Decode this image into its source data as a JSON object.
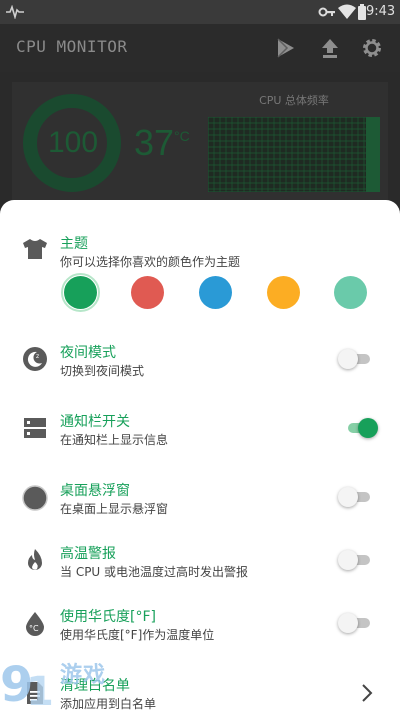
{
  "status_bar": {
    "time": "9:43"
  },
  "app": {
    "title": "CPU MONITOR"
  },
  "toolbar": {
    "icons": [
      "play-store-icon",
      "upload-icon",
      "settings-gear-icon"
    ]
  },
  "dashboard": {
    "load_percent": "100",
    "temperature": "37",
    "temperature_unit": "°C",
    "frequency_label": "CPU 总体频率"
  },
  "settings": {
    "theme": {
      "title": "主题",
      "subtitle": "你可以选择你喜欢的颜色作为主题",
      "colors": [
        "#17a05a",
        "#e05a52",
        "#2a9ad6",
        "#fcad23",
        "#6acaaa"
      ],
      "selected_index": 0
    },
    "night_mode": {
      "title": "夜间模式",
      "subtitle": "切换到夜间模式",
      "enabled": false
    },
    "notification": {
      "title": "通知栏开关",
      "subtitle": "在通知栏上显示信息",
      "enabled": true
    },
    "floating_window": {
      "title": "桌面悬浮窗",
      "subtitle": "在桌面上显示悬浮窗",
      "enabled": false
    },
    "high_temp_alert": {
      "title": "高温警报",
      "subtitle": "当 CPU 或电池温度过高时发出警报",
      "enabled": false
    },
    "fahrenheit": {
      "title": "使用华氏度[°F]",
      "subtitle": "使用华氏度[°F]作为温度单位",
      "enabled": false
    },
    "whitelist": {
      "title": "清理白名单",
      "subtitle": "添加应用到白名单"
    }
  },
  "watermark": {
    "text": "游戏"
  },
  "accent": "#17a05a"
}
